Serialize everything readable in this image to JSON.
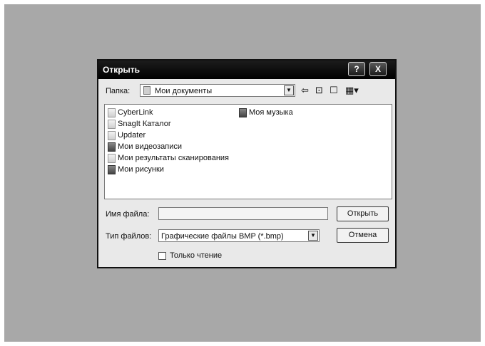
{
  "dialog": {
    "title": "Открыть",
    "help_label": "?",
    "close_label": "X"
  },
  "folder": {
    "label": "Папка:",
    "value": "Мои документы"
  },
  "toolbar": {
    "back_icon": "back-arrow-icon",
    "up_icon": "up-folder-icon",
    "new_folder_icon": "new-folder-icon",
    "views_icon": "view-menu-icon"
  },
  "files": {
    "col1": [
      {
        "name": "CyberLink",
        "icon": "folder-icon"
      },
      {
        "name": "SnagIt Каталог",
        "icon": "folder-icon"
      },
      {
        "name": "Updater",
        "icon": "folder-icon"
      },
      {
        "name": "Мои видеозаписи",
        "icon": "video-folder-icon"
      },
      {
        "name": "Мои результаты сканирования",
        "icon": "folder-icon"
      },
      {
        "name": "Мои рисунки",
        "icon": "pictures-folder-icon"
      }
    ],
    "col2": [
      {
        "name": "Моя музыка",
        "icon": "music-folder-icon"
      }
    ]
  },
  "filename": {
    "label": "Имя файла:",
    "value": ""
  },
  "filetype": {
    "label": "Тип файлов:",
    "value": "Графические файлы BMP (*.bmp)"
  },
  "buttons": {
    "open": "Открыть",
    "cancel": "Отмена"
  },
  "readonly": {
    "label": "Только чтение",
    "checked": false
  }
}
